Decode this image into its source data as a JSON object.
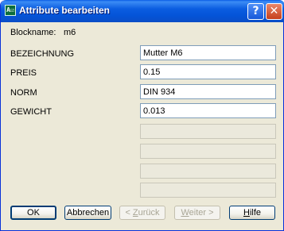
{
  "window": {
    "title": "Attribute bearbeiten",
    "icon": "block-attribute-icon",
    "app_icon_glyph": "A☑",
    "caption_buttons": {
      "help": "?",
      "close": "✕"
    }
  },
  "block": {
    "label": "Blockname:",
    "value": "m6"
  },
  "attributes": [
    {
      "name": "BEZEICHNUNG",
      "value": "Mutter M6"
    },
    {
      "name": "PREIS",
      "value": "0.15"
    },
    {
      "name": "NORM",
      "value": "DIN 934"
    },
    {
      "name": "GEWICHT",
      "value": "0.013"
    }
  ],
  "empty_field_count": 4,
  "buttons": {
    "ok": {
      "pre": "",
      "ul": "",
      "post": "OK"
    },
    "cancel": {
      "pre": "",
      "ul": "",
      "post": "Abbrechen"
    },
    "back": {
      "pre": "< ",
      "ul": "Z",
      "post": "urück"
    },
    "next": {
      "pre": "",
      "ul": "W",
      "post": "eiter >"
    },
    "help": {
      "pre": "",
      "ul": "H",
      "post": "ilfe"
    }
  },
  "colors": {
    "title_bar": "#0454d8",
    "dialog_bg": "#ece9d8",
    "field_border": "#7f9db9",
    "button_border": "#003c74"
  }
}
